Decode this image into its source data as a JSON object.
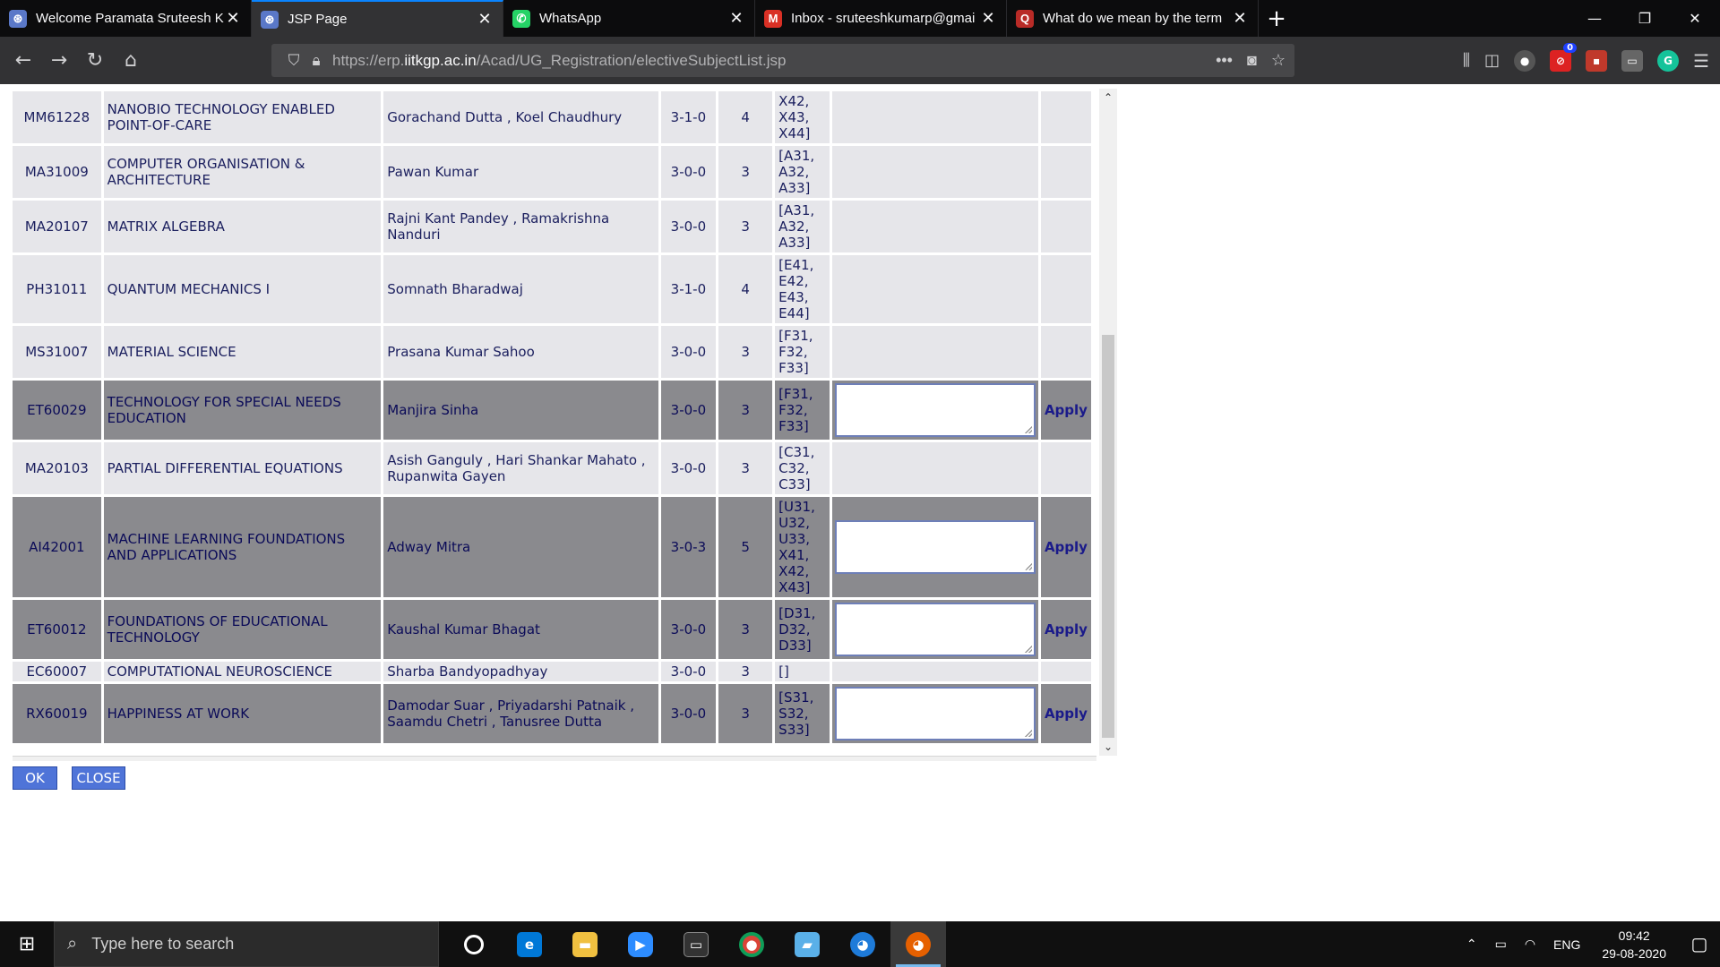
{
  "browser": {
    "tabs": [
      {
        "title": "Welcome Paramata Sruteesh Ku",
        "favicon_color": "#5a78c8",
        "favicon_glyph": "⊛",
        "active": false
      },
      {
        "title": "JSP Page",
        "favicon_color": "#5a78c8",
        "favicon_glyph": "⊛",
        "active": true
      },
      {
        "title": "WhatsApp",
        "favicon_color": "#25d366",
        "favicon_glyph": "✆",
        "active": false
      },
      {
        "title": "Inbox - sruteeshkumarp@gmai",
        "favicon_color": "#d93025",
        "favicon_glyph": "M",
        "active": false
      },
      {
        "title": "What do we mean by the term",
        "favicon_color": "#b92b27",
        "favicon_glyph": "Q",
        "active": false
      }
    ],
    "url_prefix": "https://erp.",
    "url_host": "iitkgp.ac.in",
    "url_path": "/Acad/UG_Registration/electiveSubjectList.jsp",
    "extension_badge": "0"
  },
  "table": {
    "rows": [
      {
        "code": "MM61228",
        "name": "NANOBIO TECHNOLOGY ENABLED POINT-OF-CARE",
        "instructor": "Gorachand Dutta , Koel Chaudhury",
        "ltp": "3-1-0",
        "credits": "4",
        "slots": "X42,\nX43,\nX44]",
        "available": false
      },
      {
        "code": "MA31009",
        "name": "COMPUTER ORGANISATION & ARCHITECTURE",
        "instructor": "Pawan Kumar",
        "ltp": "3-0-0",
        "credits": "3",
        "slots": "[A31,\nA32,\nA33]",
        "available": false
      },
      {
        "code": "MA20107",
        "name": "MATRIX ALGEBRA",
        "instructor": "Rajni Kant Pandey , Ramakrishna Nanduri",
        "ltp": "3-0-0",
        "credits": "3",
        "slots": "[A31,\nA32,\nA33]",
        "available": false
      },
      {
        "code": "PH31011",
        "name": "QUANTUM MECHANICS I",
        "instructor": "Somnath Bharadwaj",
        "ltp": "3-1-0",
        "credits": "4",
        "slots": "[E41,\nE42,\nE43,\nE44]",
        "available": false
      },
      {
        "code": "MS31007",
        "name": "MATERIAL SCIENCE",
        "instructor": "Prasana Kumar Sahoo",
        "ltp": "3-0-0",
        "credits": "3",
        "slots": "[F31,\nF32,\nF33]",
        "available": false
      },
      {
        "code": "ET60029",
        "name": "TECHNOLOGY FOR SPECIAL NEEDS EDUCATION",
        "instructor": "Manjira Sinha",
        "ltp": "3-0-0",
        "credits": "3",
        "slots": "[F31,\nF32,\nF33]",
        "available": true
      },
      {
        "code": "MA20103",
        "name": "PARTIAL DIFFERENTIAL EQUATIONS",
        "instructor": "Asish Ganguly , Hari Shankar Mahato , Rupanwita Gayen",
        "ltp": "3-0-0",
        "credits": "3",
        "slots": "[C31,\nC32,\nC33]",
        "available": false
      },
      {
        "code": "AI42001",
        "name": "MACHINE LEARNING FOUNDATIONS AND APPLICATIONS",
        "instructor": "Adway Mitra",
        "ltp": "3-0-3",
        "credits": "5",
        "slots": "[U31,\nU32,\nU33,\nX41,\nX42,\nX43]",
        "available": true
      },
      {
        "code": "ET60012",
        "name": "FOUNDATIONS OF EDUCATIONAL TECHNOLOGY",
        "instructor": "Kaushal Kumar Bhagat",
        "ltp": "3-0-0",
        "credits": "3",
        "slots": "[D31,\nD32,\nD33]",
        "available": true
      },
      {
        "code": "EC60007",
        "name": "COMPUTATIONAL NEUROSCIENCE",
        "instructor": "Sharba Bandyopadhyay",
        "ltp": "3-0-0",
        "credits": "3",
        "slots": "[]",
        "available": false
      },
      {
        "code": "RX60019",
        "name": "HAPPINESS AT WORK",
        "instructor": "Damodar Suar , Priyadarshi Patnaik , Saamdu Chetri , Tanusree Dutta",
        "ltp": "3-0-0",
        "credits": "3",
        "slots": "[S31,\nS32,\nS33]",
        "available": true
      }
    ],
    "apply_label": "Apply"
  },
  "buttons": {
    "ok": "OK",
    "close": "CLOSE"
  },
  "taskbar": {
    "search_placeholder": "Type here to search",
    "language": "ENG",
    "time": "09:42",
    "date": "29-08-2020"
  }
}
